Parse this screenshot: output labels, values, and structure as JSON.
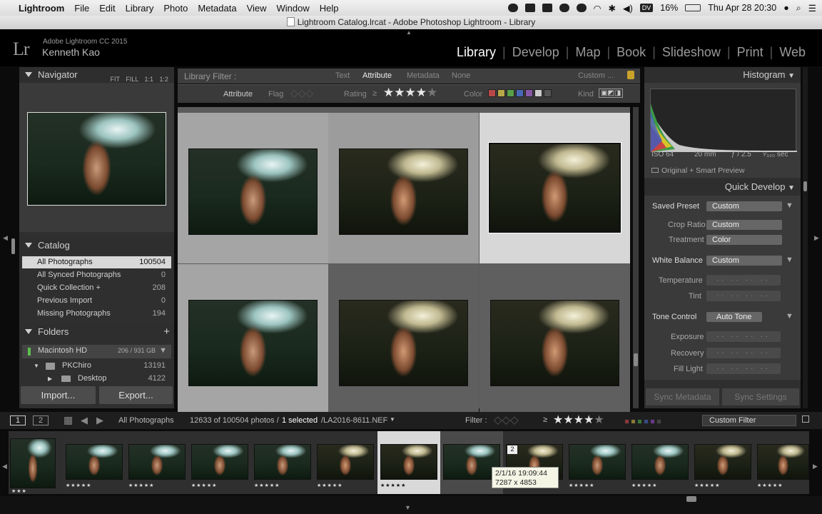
{
  "menubar": {
    "app": "Lightroom",
    "items": [
      "File",
      "Edit",
      "Library",
      "Photo",
      "Metadata",
      "View",
      "Window",
      "Help"
    ],
    "battery": "16%",
    "clock": "Thu Apr 28  20:30",
    "lang": "DV"
  },
  "title": "Lightroom Catalog.lrcat - Adobe Photoshop Lightroom - Library",
  "identity": {
    "logo": "Lr",
    "version": "Adobe Lightroom CC 2015",
    "user": "Kenneth Kao"
  },
  "modules": [
    "Library",
    "Develop",
    "Map",
    "Book",
    "Slideshow",
    "Print",
    "Web"
  ],
  "navigator": {
    "title": "Navigator",
    "opts": "FIT  FILL  1:1  1:2"
  },
  "catalog": {
    "title": "Catalog",
    "rows": [
      {
        "label": "All Photographs",
        "count": "100504"
      },
      {
        "label": "All Synced Photographs",
        "count": "0"
      },
      {
        "label": "Quick Collection  +",
        "count": "208"
      },
      {
        "label": "Previous Import",
        "count": "0"
      },
      {
        "label": "Missing Photographs",
        "count": "194"
      }
    ]
  },
  "folders": {
    "title": "Folders",
    "volume": "Macintosh HD",
    "volume_size": "206 / 931 GB",
    "rows": [
      {
        "label": "PKChiro",
        "count": "13191"
      },
      {
        "label": "Desktop",
        "count": "4122"
      }
    ]
  },
  "buttons": {
    "import": "Import...",
    "export": "Export..."
  },
  "library_filter": {
    "title": "Library Filter :",
    "tabs": [
      "Text",
      "Attribute",
      "Metadata",
      "None"
    ],
    "preset": "Custom ...",
    "attribute": "Attribute",
    "flag": "Flag",
    "rating": "Rating",
    "color": "Color",
    "kind": "Kind",
    "ge": "≥"
  },
  "histogram": {
    "title": "Histogram",
    "iso": "ISO 64",
    "focal": "20 mm",
    "aperture": "ƒ / 2.5",
    "shutter": "¹⁄₃₂₀ sec",
    "preview": "Original + Smart Preview"
  },
  "quick_develop": {
    "title": "Quick Develop",
    "saved_preset": "Saved Preset",
    "saved_preset_val": "Custom",
    "crop_ratio": "Crop Ratio",
    "crop_ratio_val": "Custom",
    "treatment": "Treatment",
    "treatment_val": "Color",
    "white_balance": "White Balance",
    "white_balance_val": "Custom",
    "temperature": "Temperature",
    "tint": "Tint",
    "tone_control": "Tone Control",
    "auto_tone": "Auto Tone",
    "exposure": "Exposure",
    "recovery": "Recovery",
    "fill_light": "Fill Light"
  },
  "sync": {
    "metadata": "Sync Metadata",
    "settings": "Sync Settings"
  },
  "toolbar": {
    "view1": "1",
    "view2": "2",
    "source": "All Photographs",
    "count_prefix": "12633 of 100504 photos /",
    "selected": "1 selected",
    "filename": "/LA2016-8611.NEF",
    "filter_label": "Filter :",
    "custom_filter": "Custom Filter"
  },
  "tooltip": {
    "date": "2/1/16 19:09:44",
    "dims": "7287 x 4853",
    "badge": "2"
  },
  "filmstrip_rating": "★★★★★",
  "colors": {
    "red": "#b84848",
    "yellow": "#b8a848",
    "green": "#58a048",
    "blue": "#4868b8",
    "purple": "#8858a8"
  }
}
